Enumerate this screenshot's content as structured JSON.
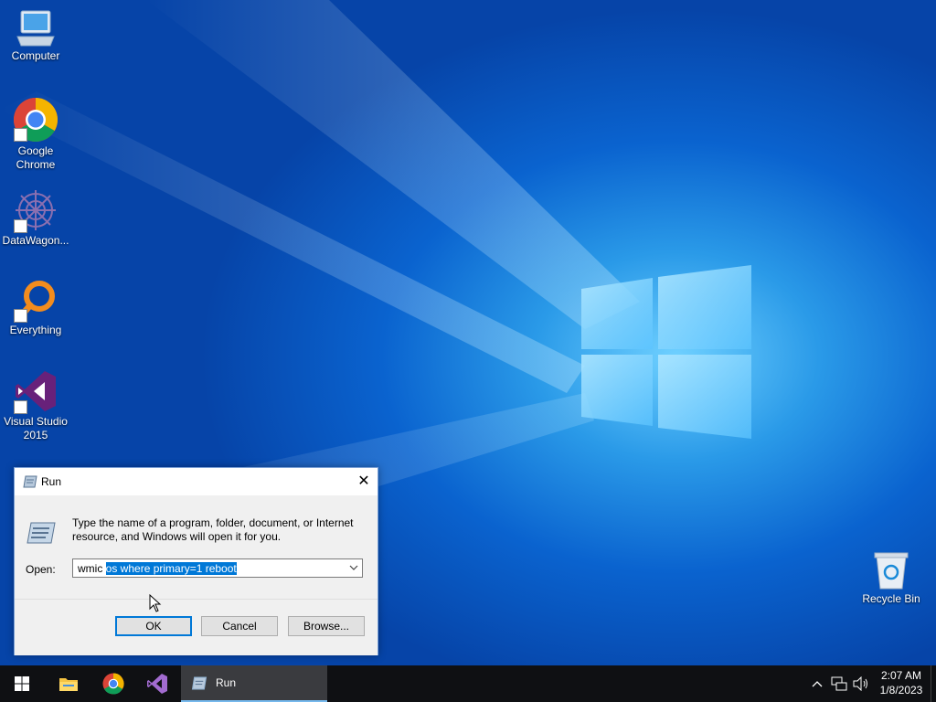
{
  "desktop_icons": [
    {
      "label": "Computer",
      "icon": "computer-icon"
    },
    {
      "label": "Google Chrome",
      "icon": "chrome-icon"
    },
    {
      "label": "DataWagon...",
      "icon": "datawagon-icon"
    },
    {
      "label": "Everything",
      "icon": "everything-icon"
    },
    {
      "label": "Visual Studio 2015",
      "icon": "visual-studio-icon"
    },
    {
      "label": "Recycle Bin",
      "icon": "recycle-bin-icon"
    }
  ],
  "run_dialog": {
    "title": "Run",
    "description": "Type the name of a program, folder, document, or Internet resource, and Windows will open it for you.",
    "open_label": "Open:",
    "command_unselected": "wmic ",
    "command_selected": "os where primary=1 reboot",
    "ok_label": "OK",
    "cancel_label": "Cancel",
    "browse_label": "Browse..."
  },
  "taskbar": {
    "active_window": "Run",
    "time": "2:07 AM",
    "date": "1/8/2023"
  },
  "colors": {
    "accent": "#0078d7",
    "taskbar": "#0f1013",
    "selection": "#0078d7"
  }
}
